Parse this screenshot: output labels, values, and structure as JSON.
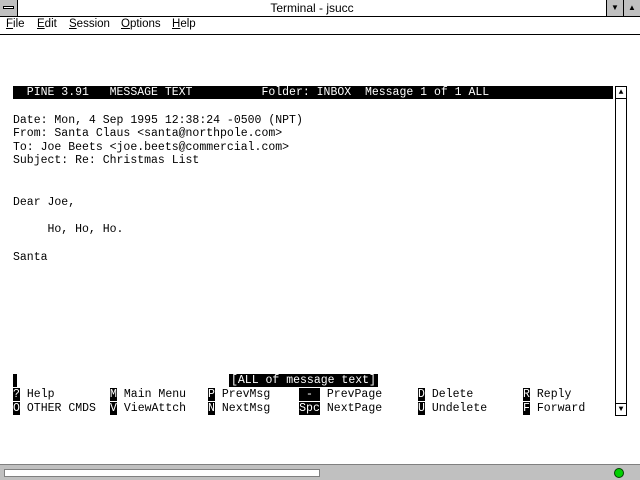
{
  "window": {
    "title": "Terminal - jsucc"
  },
  "menu": [
    {
      "label": "File",
      "ul": "F",
      "rest": "ile"
    },
    {
      "label": "Edit",
      "ul": "E",
      "rest": "dit"
    },
    {
      "label": "Session",
      "ul": "S",
      "rest": "ession"
    },
    {
      "label": "Options",
      "ul": "O",
      "rest": "ptions"
    },
    {
      "label": "Help",
      "ul": "H",
      "rest": "elp"
    }
  ],
  "pine": {
    "status": "  PINE 3.91   MESSAGE TEXT          Folder: INBOX  Message 1 of 1 ALL",
    "date": "Date: Mon, 4 Sep 1995 12:38:24 -0500 (NPT)",
    "from": "From: Santa Claus <santa@northpole.com>",
    "to": "To: Joe Beets <joe.beets@commercial.com>",
    "subject": "Subject: Re: Christmas List",
    "body1": "Dear Joe,",
    "body2": "     Ho, Ho, Ho.",
    "body3": "Santa",
    "message": "[ALL of message text]"
  },
  "commands": {
    "row1": [
      {
        "key": "?",
        "label": "Help"
      },
      {
        "key": "M",
        "label": "Main Menu"
      },
      {
        "key": "P",
        "label": "PrevMsg"
      },
      {
        "key": "-",
        "label": "PrevPage"
      },
      {
        "key": "D",
        "label": "Delete"
      },
      {
        "key": "R",
        "label": "Reply"
      }
    ],
    "row2": [
      {
        "key": "O",
        "label": "OTHER CMDS"
      },
      {
        "key": "V",
        "label": "ViewAttch"
      },
      {
        "key": "N",
        "label": "NextMsg"
      },
      {
        "key": "Spc",
        "label": "NextPage"
      },
      {
        "key": "U",
        "label": "Undelete"
      },
      {
        "key": "F",
        "label": "Forward"
      }
    ]
  },
  "colors": {
    "led": "#00d000",
    "chrome": "#c0c0c0"
  },
  "icons": {
    "system": "system-menu-icon",
    "minimize": "minimize-icon",
    "maximize": "maximize-icon",
    "status": "connection-led-icon"
  }
}
